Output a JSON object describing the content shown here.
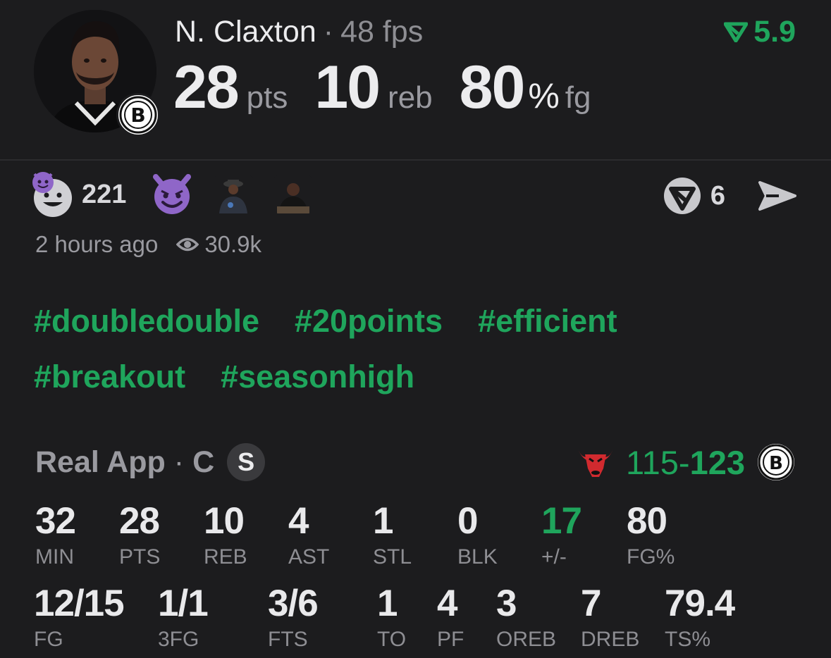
{
  "header": {
    "player_name": "N. Claxton",
    "separator": "·",
    "fps": "48 fps",
    "rating": "5.9",
    "stats": [
      {
        "value": "28",
        "unit": "pts"
      },
      {
        "value": "10",
        "unit": "reb"
      },
      {
        "value": "80",
        "pct": "%",
        "unit": "fg"
      }
    ]
  },
  "reactions": {
    "count": "221",
    "share_count": "6"
  },
  "meta": {
    "time": "2 hours ago",
    "views": "30.9k"
  },
  "hashtags": [
    "#doubledouble",
    "#20points",
    "#efficient",
    "#breakout",
    "#seasonhigh"
  ],
  "gameline": {
    "app": "Real App",
    "separator": "·",
    "position": "C",
    "badge": "S",
    "score_away": "115",
    "score_dash": "-",
    "score_home": "123"
  },
  "stats_row1": [
    {
      "value": "32",
      "label": "MIN"
    },
    {
      "value": "28",
      "label": "PTS"
    },
    {
      "value": "10",
      "label": "REB"
    },
    {
      "value": "4",
      "label": "AST"
    },
    {
      "value": "1",
      "label": "STL"
    },
    {
      "value": "0",
      "label": "BLK"
    },
    {
      "value": "17",
      "label": "+/-"
    },
    {
      "value": "80",
      "label": "FG%"
    }
  ],
  "stats_row2": [
    {
      "value": "12/15",
      "label": "FG"
    },
    {
      "value": "1/1",
      "label": "3FG"
    },
    {
      "value": "3/6",
      "label": "FTS"
    },
    {
      "value": "1",
      "label": "TO"
    },
    {
      "value": "4",
      "label": "PF"
    },
    {
      "value": "3",
      "label": "OREB"
    },
    {
      "value": "7",
      "label": "DREB"
    },
    {
      "value": "79.4",
      "label": "TS%"
    }
  ],
  "colors": {
    "accent_green": "#1fa55c",
    "background": "#1c1c1e",
    "devil_purple": "#8f66c8"
  },
  "icons": [
    "player-avatar",
    "nets-logo",
    "rating-arrow-icon",
    "devil-smiley-icon",
    "devil-emoji-icon",
    "view-eye-icon",
    "share-app-icon",
    "send-icon",
    "bulls-logo"
  ]
}
